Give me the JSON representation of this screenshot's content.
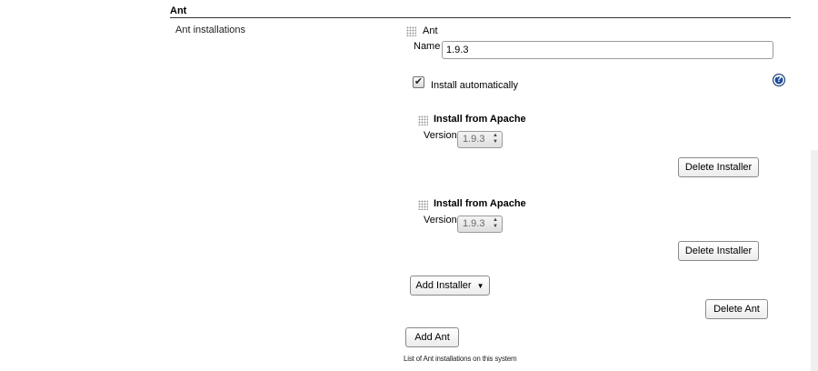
{
  "section": {
    "title": "Ant",
    "row_label": "Ant installations"
  },
  "ant": {
    "header_label": "Ant",
    "name_label": "Name",
    "name_value": "1.9.3",
    "install_auto_label": "Install automatically",
    "install_auto_checked": true,
    "help_icon_glyph": "?",
    "installers": [
      {
        "title": "Install from Apache",
        "version_label": "Version",
        "version_value": "1.9.3",
        "delete_label": "Delete Installer"
      },
      {
        "title": "Install from Apache",
        "version_label": "Version",
        "version_value": "1.9.3",
        "delete_label": "Delete Installer"
      }
    ],
    "add_installer_label": "Add Installer",
    "delete_ant_label": "Delete Ant"
  },
  "add_ant_label": "Add Ant",
  "caption": "List of Ant installations on this system",
  "icons": {
    "drag_handle": "drag-handle-icon",
    "help": "help-icon",
    "dropdown_arrow": "caret-down-icon",
    "spinner": "spinner-arrows-icon"
  },
  "colors": {
    "help_icon": "#1f4f9d",
    "rule": "#333333"
  }
}
